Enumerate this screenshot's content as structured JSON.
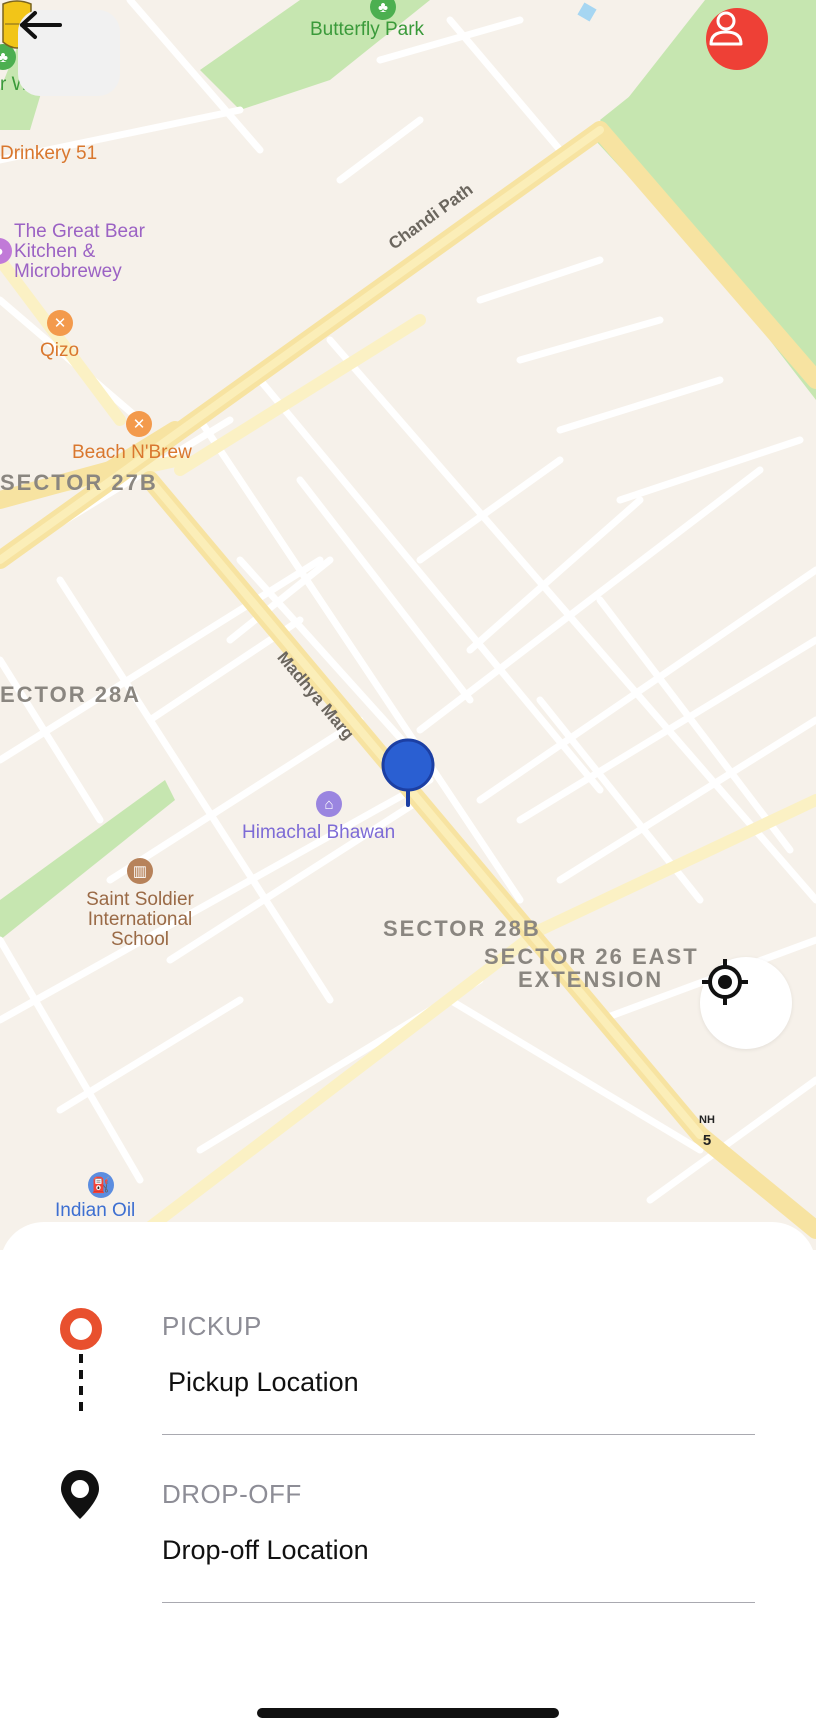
{
  "map": {
    "areas": [
      "SECTOR 27B",
      "ECTOR 28A",
      "SECTOR 28B",
      "SECTOR 26 EAST",
      "EXTENSION"
    ],
    "roads": {
      "chandi_path": "Chandi Path",
      "madhya_marg": "Madhya Marg"
    },
    "pois": {
      "butterfly_park": "Butterfly Park",
      "drinkery": "Drinkery 51",
      "great_bear_1": "The Great Bear",
      "great_bear_2": "Kitchen &",
      "great_bear_3": "Microbrewey",
      "qizo": "Qizo",
      "beach_n_brew": "Beach N'Brew",
      "himachal_bhawan": "Himachal Bhawan",
      "saint_soldier_1": "Saint Soldier",
      "saint_soldier_2": "International",
      "saint_soldier_3": "School",
      "indian_oil": "Indian Oil",
      "cut_off_left": "r W"
    },
    "highway_shield": {
      "top": "NH",
      "bottom": "5"
    }
  },
  "controls": {
    "back": "back-arrow-icon",
    "profile": "user-icon",
    "locate": "crosshair-icon"
  },
  "sheet": {
    "pickup": {
      "title": "PICKUP",
      "value": "Pickup Location"
    },
    "dropoff": {
      "title": "DROP-OFF",
      "value": "Drop-off Location"
    }
  },
  "colors": {
    "accent": "#ee4036",
    "pin_blue": "#2a5fd2",
    "park_green": "#c6e6b0",
    "map_bg": "#f6f1ea"
  }
}
